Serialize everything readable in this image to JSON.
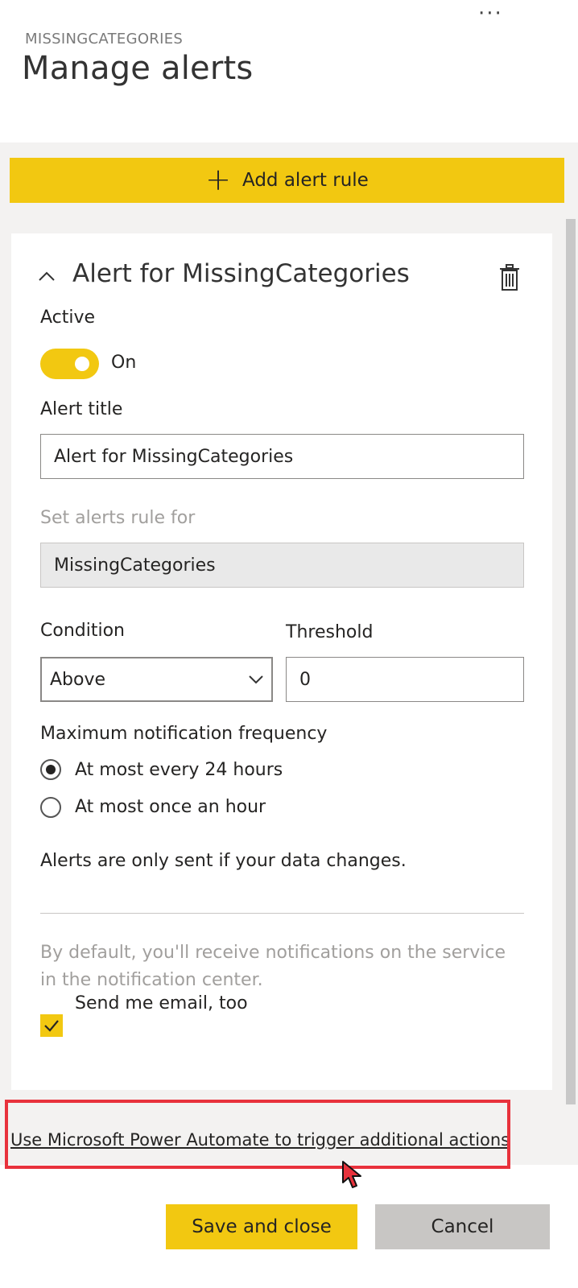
{
  "header": {
    "subtitle": "MISSINGCATEGORIES",
    "title": "Manage alerts",
    "more_icon": "ellipsis-icon"
  },
  "toolbar": {
    "add_rule_label": "Add alert rule"
  },
  "alert": {
    "heading": "Alert for MissingCategories",
    "active_label": "Active",
    "active_state": "On",
    "title_label": "Alert title",
    "title_value": "Alert for MissingCategories",
    "rule_for_label": "Set alerts rule for",
    "rule_for_value": "MissingCategories",
    "condition_label": "Condition",
    "condition_value": "Above",
    "threshold_label": "Threshold",
    "threshold_value": "0",
    "frequency_label": "Maximum notification frequency",
    "frequency_options": [
      "At most every 24 hours",
      "At most once an hour"
    ],
    "frequency_selected": "At most every 24 hours",
    "data_change_note": "Alerts are only sent if your data changes.",
    "default_info": "By default, you'll receive notifications on the service in the notification center.",
    "email_label": "Send me email, too",
    "email_checked": true
  },
  "footer": {
    "power_automate_link": "Use Microsoft Power Automate to trigger additional actions",
    "save_label": "Save and close",
    "cancel_label": "Cancel"
  },
  "colors": {
    "accent": "#f2c811",
    "panel_bg": "#f3f2f1",
    "highlight": "#e8323c"
  }
}
